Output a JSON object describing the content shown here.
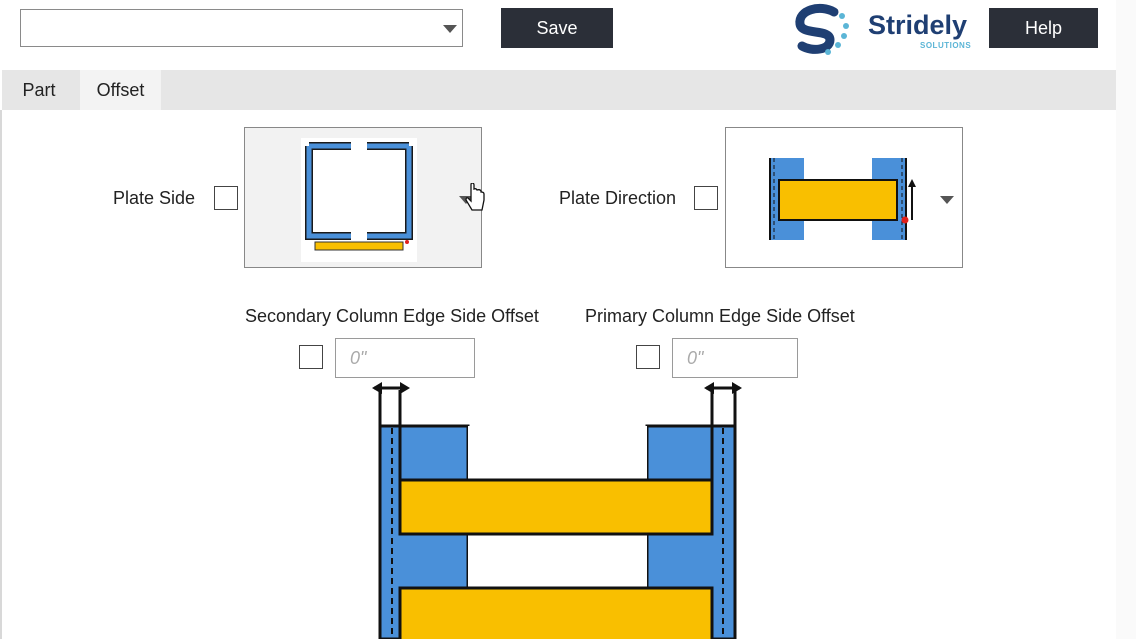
{
  "toolbar": {
    "dropdown_value": "",
    "save_label": "Save",
    "help_label": "Help"
  },
  "logo": {
    "name": "Stridely",
    "tagline": "SOLUTIONS"
  },
  "tabs": [
    {
      "label": "Part",
      "active": false
    },
    {
      "label": "Offset",
      "active": true
    }
  ],
  "plate_side": {
    "label": "Plate Side",
    "checked": false
  },
  "plate_direction": {
    "label": "Plate Direction",
    "checked": false
  },
  "secondary_offset": {
    "label": "Secondary Column Edge Side Offset",
    "value": "0\"",
    "checked": false
  },
  "primary_offset": {
    "label": "Primary Column Edge Side Offset",
    "value": "0\"",
    "checked": false
  },
  "colors": {
    "column_blue": "#4a90d9",
    "plate_yellow": "#f9bf00",
    "button_dark": "#2b2f38",
    "logo_navy": "#1f3f73"
  }
}
